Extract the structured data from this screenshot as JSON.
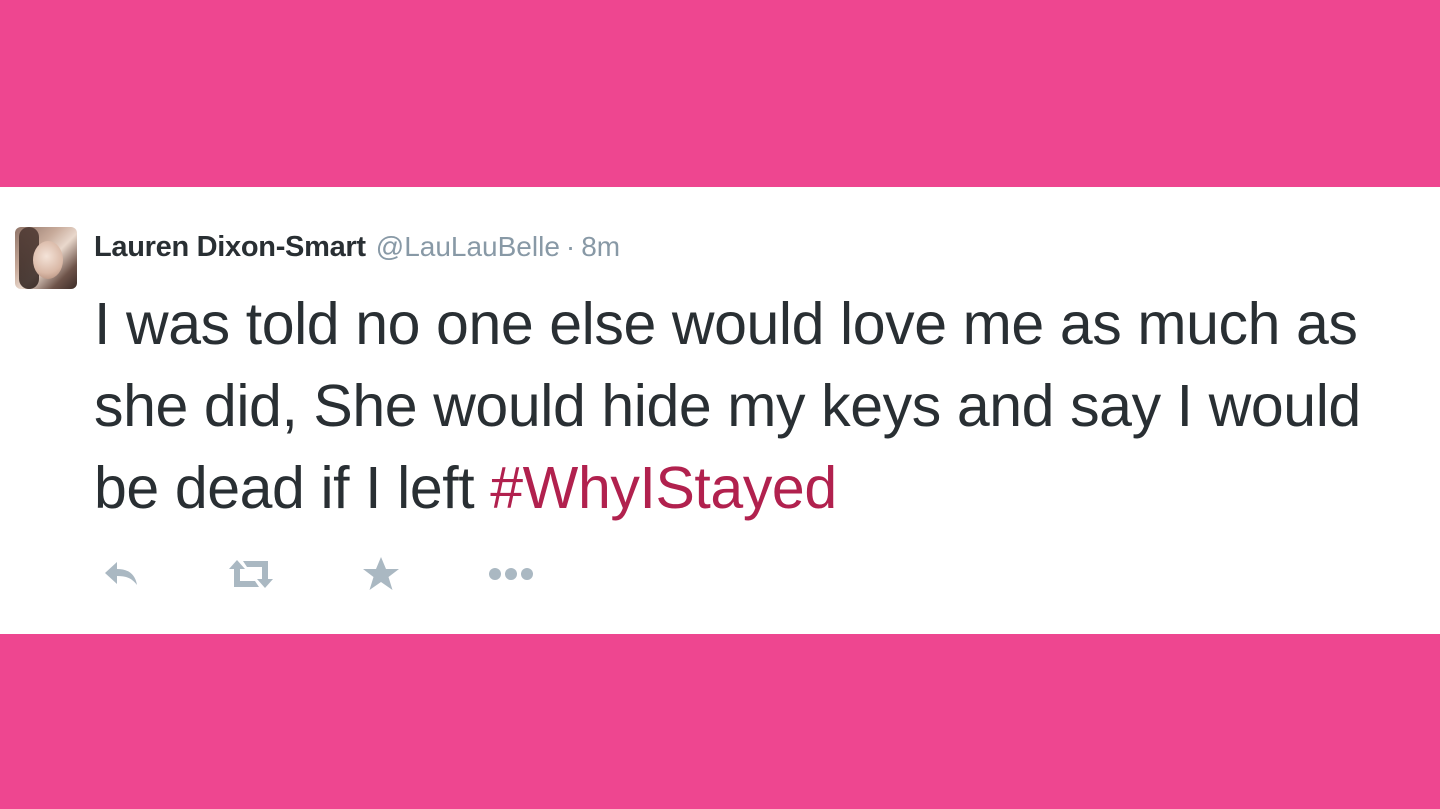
{
  "colors": {
    "background": "#ee4690",
    "card": "#ffffff",
    "text": "#292f33",
    "muted": "#8899a6",
    "hashtag": "#b1214e",
    "icon": "#aab8c2"
  },
  "tweet": {
    "author_name": "Lauren Dixon-Smart",
    "handle": "@LauLauBelle",
    "separator": "·",
    "time": "8m",
    "text_main": "I was told no one else would love me as much as she did, She would hide my keys and say I would be dead if I left ",
    "hashtag": "#WhyIStayed",
    "avatar": "profile-photo",
    "actions": [
      {
        "name": "reply",
        "icon": "reply-icon"
      },
      {
        "name": "retweet",
        "icon": "retweet-icon"
      },
      {
        "name": "favorite",
        "icon": "star-icon"
      },
      {
        "name": "more",
        "icon": "more-icon"
      }
    ]
  }
}
